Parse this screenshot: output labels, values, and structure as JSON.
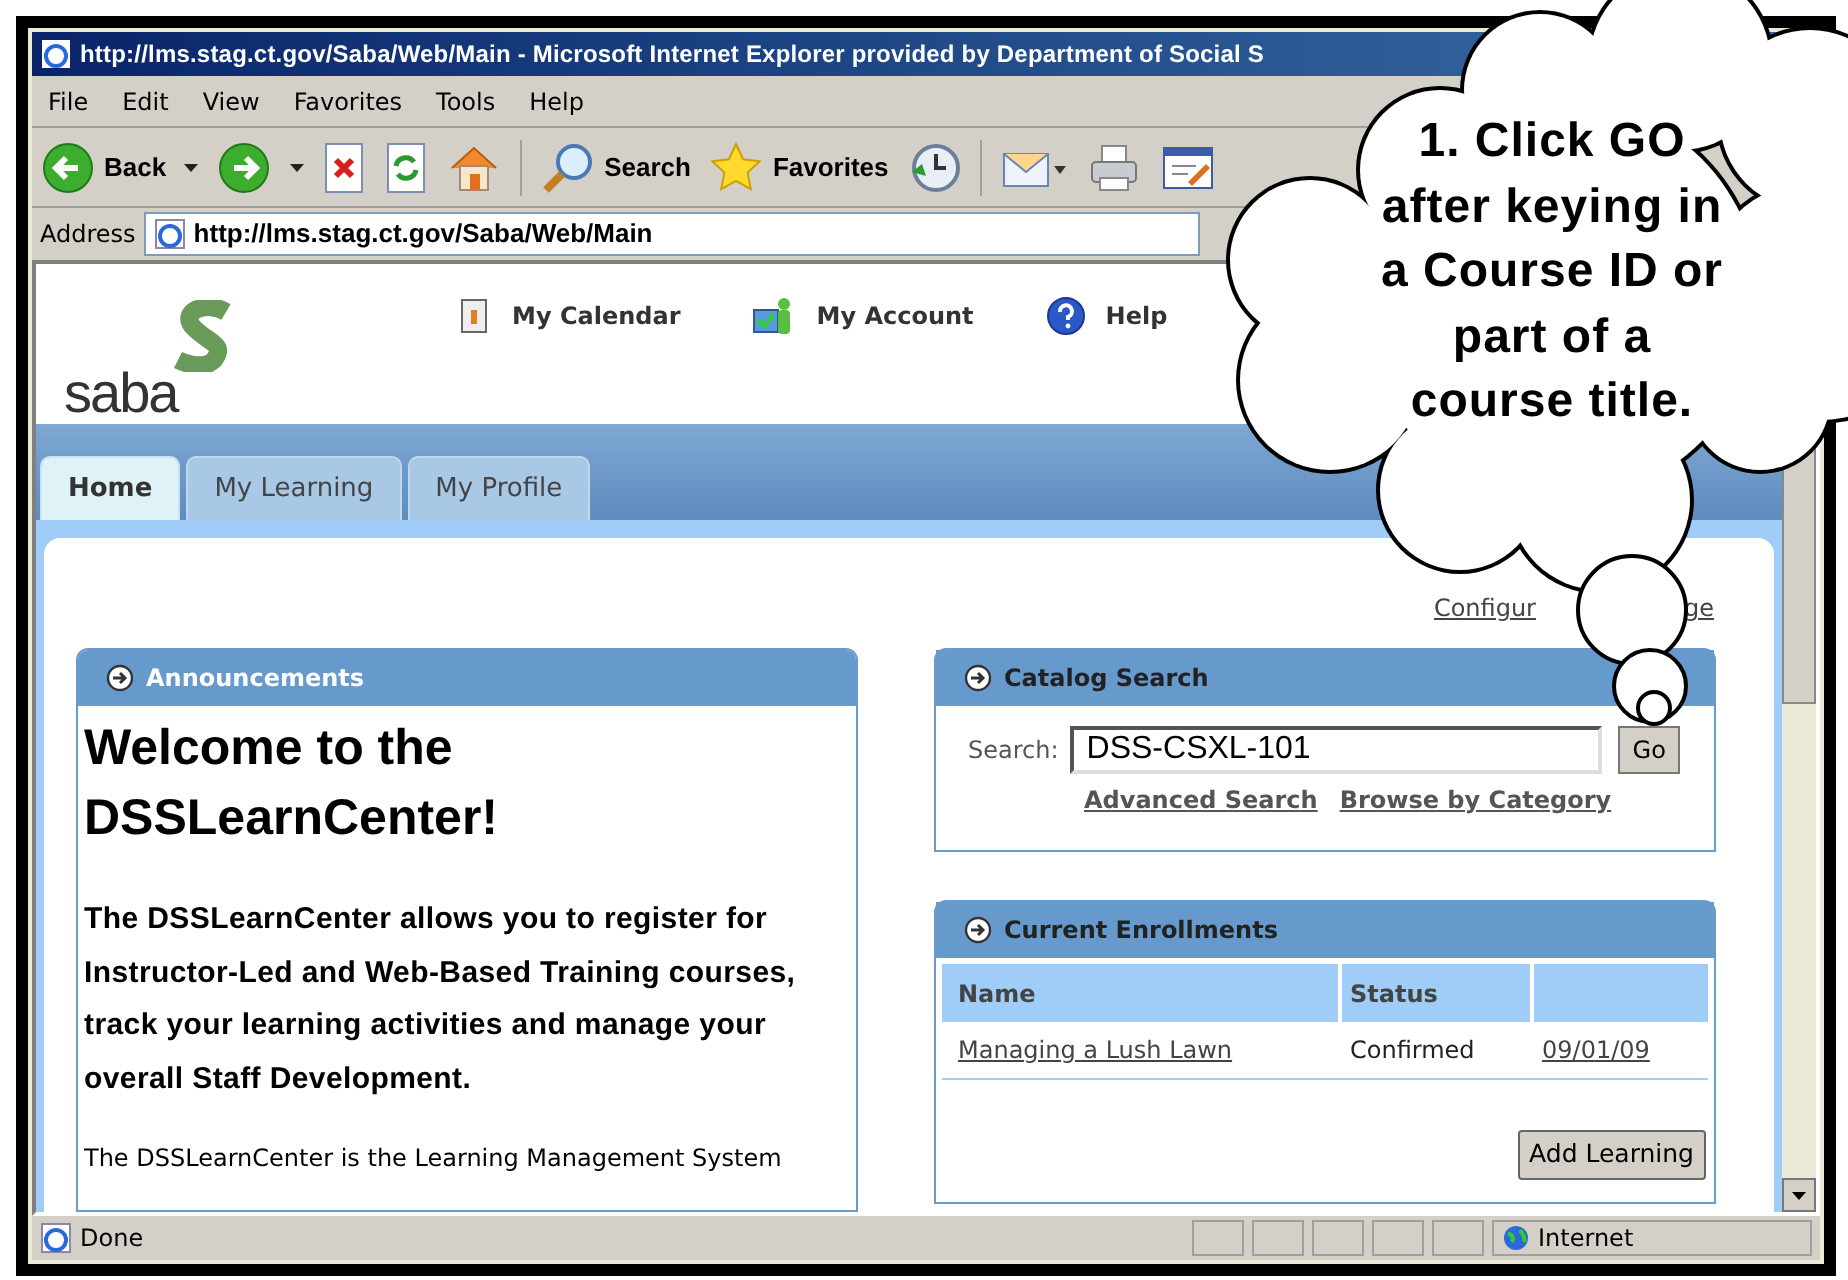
{
  "window": {
    "title": "http://lms.stag.ct.gov/Saba/Web/Main - Microsoft Internet Explorer provided by Department of Social S"
  },
  "menu": [
    "File",
    "Edit",
    "View",
    "Favorites",
    "Tools",
    "Help"
  ],
  "toolbar": [
    {
      "kind": "back",
      "label": "Back"
    },
    {
      "kind": "forward"
    },
    {
      "kind": "stop"
    },
    {
      "kind": "refresh"
    },
    {
      "kind": "home"
    },
    {
      "kind": "search",
      "label": "Search"
    },
    {
      "kind": "favorites",
      "label": "Favorites"
    },
    {
      "kind": "history"
    },
    {
      "kind": "mail"
    },
    {
      "kind": "print"
    },
    {
      "kind": "edit"
    }
  ],
  "address": {
    "label": "Address",
    "value": "http://lms.stag.ct.gov/Saba/Web/Main"
  },
  "header": {
    "logo": "saba",
    "links": [
      {
        "kind": "calendar",
        "label": "My Calendar"
      },
      {
        "kind": "account",
        "label": "My Account"
      },
      {
        "kind": "help",
        "label": "Help"
      }
    ]
  },
  "tabs": [
    {
      "label": "Home",
      "selected": true
    },
    {
      "label": "My Learning",
      "selected": false
    },
    {
      "label": "My Profile",
      "selected": false
    }
  ],
  "configure_link": {
    "start": "Configur",
    "end": "ge"
  },
  "announcements": {
    "title": "Announcements",
    "heading": "Welcome to the DSSLearnCenter!",
    "intro": "The DSSLearnCenter allows you to register for Instructor-Led and Web-Based Training courses, track your learning activities and manage your overall Staff Development.",
    "body": "The DSSLearnCenter is the Learning Management System"
  },
  "catalog_search": {
    "title": "Catalog Search",
    "label": "Search:",
    "value": "DSS-CSXL-101",
    "button": "Go",
    "links": [
      "Advanced Search",
      "Browse by Category"
    ]
  },
  "enrollments": {
    "title": "Current Enrollments",
    "columns": [
      "Name",
      "Status"
    ],
    "rows": [
      {
        "name": "Managing a Lush Lawn",
        "status": "Confirmed",
        "date": "09/01/09"
      }
    ],
    "button": "Add Learning"
  },
  "status_bar": {
    "text": "Done",
    "zone": "Internet"
  },
  "callout": {
    "text": "1. Click GO after keying in a Course ID or part of a course title."
  }
}
